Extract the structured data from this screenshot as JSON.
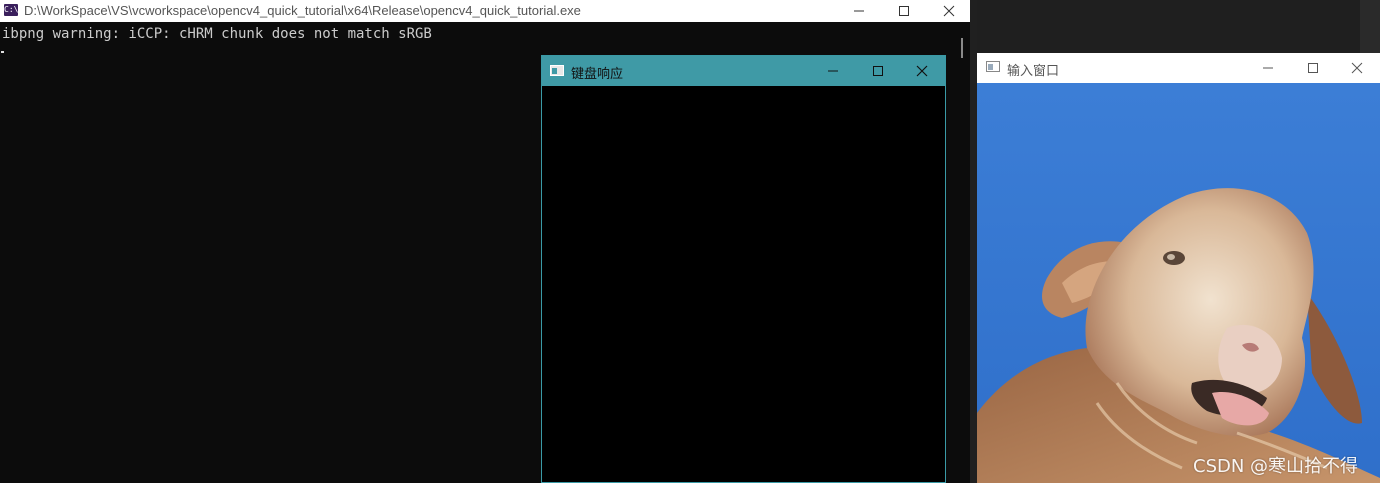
{
  "console": {
    "icon_text": "C:\\",
    "title": "D:\\WorkSpace\\VS\\vcworkspace\\opencv4_quick_tutorial\\x64\\Release\\opencv4_quick_tutorial.exe",
    "output_line": "ibpng warning: iCCP: cHRM chunk does not match sRGB"
  },
  "keyboard_window": {
    "title": "键盘响应"
  },
  "input_window": {
    "title": "输入窗口"
  },
  "watermark": "CSDN @寒山拾不得",
  "colors": {
    "keyboard_titlebar": "#3f9aa6",
    "console_bg": "#0c0c0c",
    "sky": "#3a7fd6"
  }
}
